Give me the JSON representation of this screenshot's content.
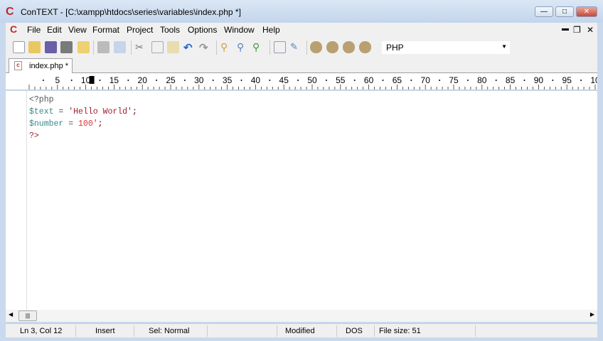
{
  "window": {
    "title": "ConTEXT - [C:\\xampp\\htdocs\\series\\variables\\index.php *]",
    "minimize": "—",
    "maximize": "□",
    "close": "✕"
  },
  "menu": [
    "File",
    "Edit",
    "View",
    "Format",
    "Project",
    "Tools",
    "Options",
    "Window",
    "Help"
  ],
  "menu_controls": {
    "minimize": "▬",
    "restore": "❐",
    "close": "✕"
  },
  "toolbar": {
    "language": "PHP"
  },
  "tab": {
    "label": "index.php *"
  },
  "ruler": [
    "5",
    "10",
    "15",
    "20",
    "25",
    "30",
    "35",
    "40",
    "45",
    "50",
    "55",
    "60",
    "65",
    "70",
    "75",
    "80",
    "85",
    "90",
    "95",
    "10"
  ],
  "code": {
    "l1": "<?php",
    "l2_var": "$text",
    "l2_op": " = ",
    "l2_str": "'Hello World'",
    "l2_end": ";",
    "l3_var": "$number",
    "l3_op": " = ",
    "l3_num": "100'",
    "l3_end": ";",
    "l4": "?>"
  },
  "status": {
    "position": "Ln 3, Col 12",
    "mode": "Insert",
    "sel": "Sel: Normal",
    "modified": "Modified",
    "format": "DOS",
    "filesize": "File size: 51"
  }
}
